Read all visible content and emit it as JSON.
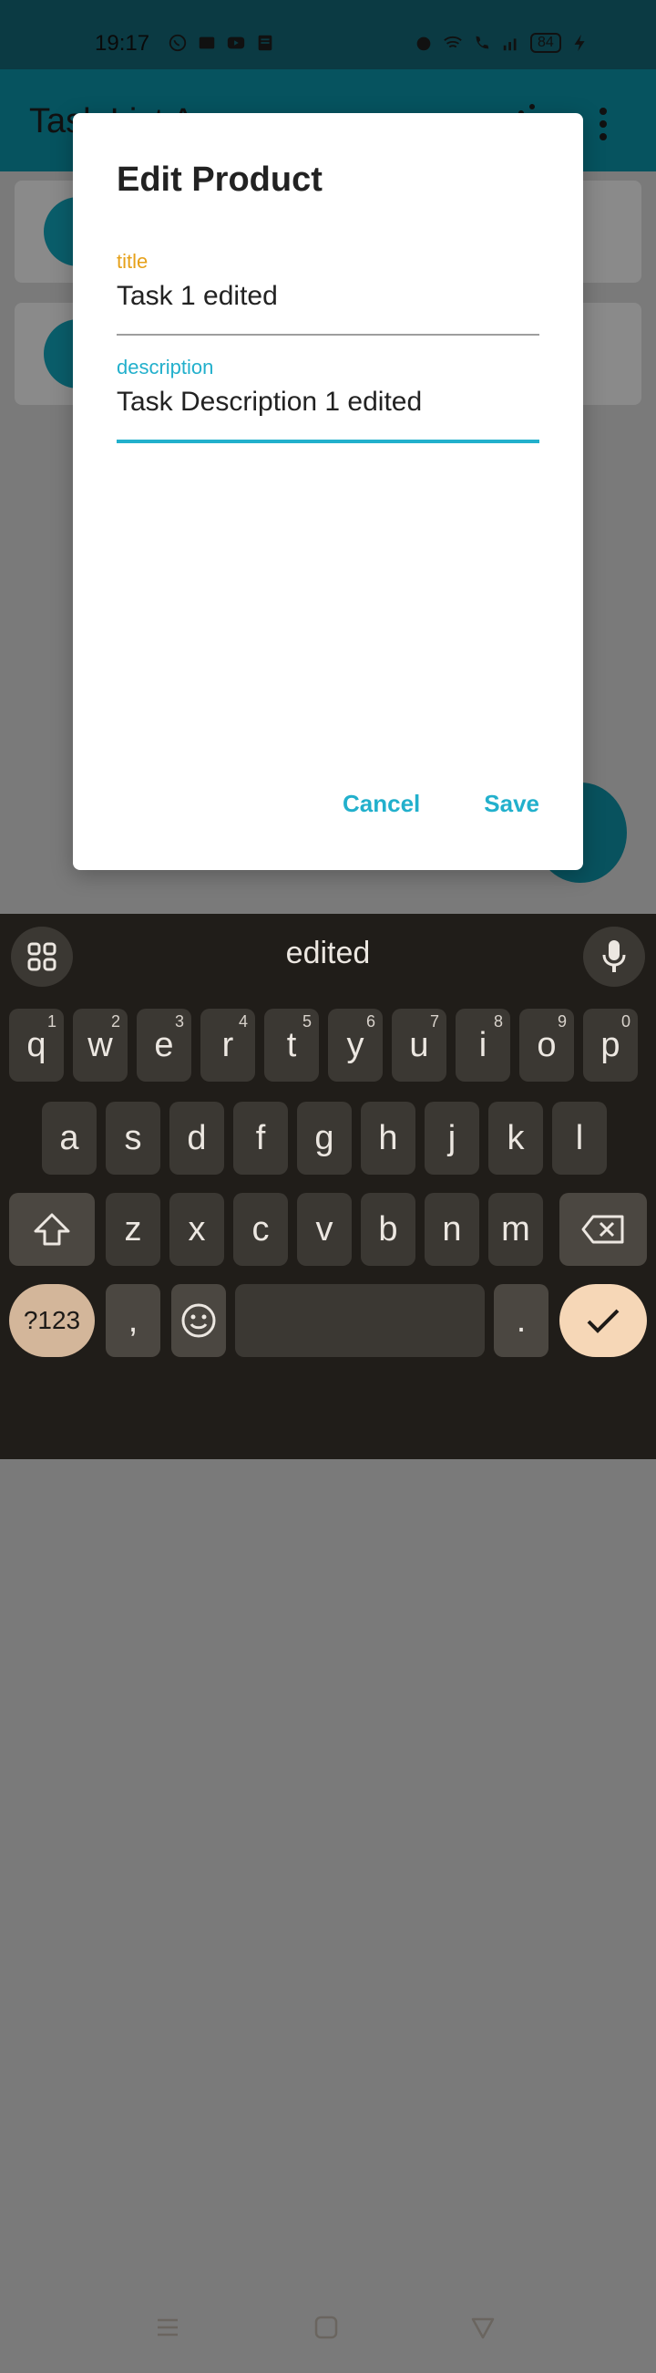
{
  "status_bar": {
    "time": "19:17",
    "battery": "84",
    "icons_left": [
      "whatsapp-icon",
      "app-icon",
      "youtube-icon",
      "news-icon"
    ],
    "icons_right": [
      "alarm-icon",
      "wifi-icon",
      "call-icon",
      "signal-icon",
      "battery-icon",
      "charging-icon"
    ]
  },
  "app_bar": {
    "title": "Task List App"
  },
  "dialog": {
    "title": "Edit Product",
    "fields": [
      {
        "label": "title",
        "value": "Task 1 edited",
        "label_color": "#e6a11a",
        "line_color": "#9e9e9e"
      },
      {
        "label": "description",
        "value": "Task Description 1 edited",
        "label_color": "#22b0cc",
        "line_color": "#22b0cc"
      }
    ],
    "cancel_label": "Cancel",
    "save_label": "Save",
    "accent": "#22b0cc"
  },
  "keyboard": {
    "suggestion": "edited",
    "row1": [
      {
        "k": "q",
        "h": "1"
      },
      {
        "k": "w",
        "h": "2"
      },
      {
        "k": "e",
        "h": "3"
      },
      {
        "k": "r",
        "h": "4"
      },
      {
        "k": "t",
        "h": "5"
      },
      {
        "k": "y",
        "h": "6"
      },
      {
        "k": "u",
        "h": "7"
      },
      {
        "k": "i",
        "h": "8"
      },
      {
        "k": "o",
        "h": "9"
      },
      {
        "k": "p",
        "h": "0"
      }
    ],
    "row2": [
      "a",
      "s",
      "d",
      "f",
      "g",
      "h",
      "j",
      "k",
      "l"
    ],
    "row3": [
      "z",
      "x",
      "c",
      "v",
      "b",
      "n",
      "m"
    ],
    "symbols_label": "?123",
    "comma_label": ",",
    "period_label": "."
  }
}
